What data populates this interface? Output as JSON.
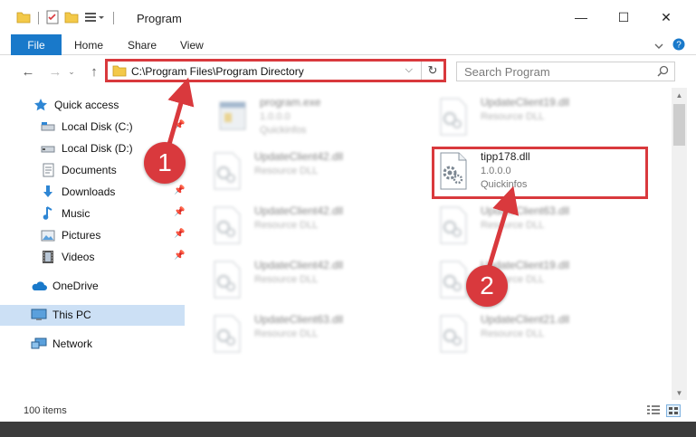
{
  "window": {
    "title": "Program",
    "controls": {
      "minimize": "—",
      "maximize": "☐",
      "close": "✕"
    }
  },
  "ribbon": {
    "file_label": "File",
    "tabs": [
      {
        "label": "Home"
      },
      {
        "label": "Share"
      },
      {
        "label": "View"
      }
    ]
  },
  "address_bar": {
    "path": "C:\\Program Files\\Program Directory",
    "search_placeholder": "Search Program"
  },
  "sidebar": {
    "items": [
      {
        "label": "Quick access",
        "icon": "star-icon"
      },
      {
        "label": "Local Disk (C:)",
        "icon": "drive-icon"
      },
      {
        "label": "Local Disk (D:)",
        "icon": "drive-icon"
      },
      {
        "label": "Documents",
        "icon": "document-icon"
      },
      {
        "label": "Downloads",
        "icon": "download-icon"
      },
      {
        "label": "Music",
        "icon": "music-icon"
      },
      {
        "label": "Pictures",
        "icon": "pictures-icon"
      },
      {
        "label": "Videos",
        "icon": "videos-icon"
      },
      {
        "label": "OneDrive",
        "icon": "cloud-icon"
      },
      {
        "label": "This PC",
        "icon": "computer-icon"
      },
      {
        "label": "Network",
        "icon": "network-icon"
      }
    ]
  },
  "files": [
    {
      "name": "program.exe",
      "meta1": "1.0.0.0",
      "meta2": "Quickinfos",
      "icon": "exe-icon",
      "blurred": true
    },
    {
      "name": "UpdateClient19.dll",
      "meta1": "Resource DLL",
      "meta2": "",
      "icon": "dll-icon",
      "blurred": true
    },
    {
      "name": "UpdateClient42.dll",
      "meta1": "Resource DLL",
      "meta2": "",
      "icon": "dll-icon",
      "blurred": true
    },
    {
      "name": "tipp178.dll",
      "meta1": "1.0.0.0",
      "meta2": "Quickinfos",
      "icon": "dll-gear-icon",
      "blurred": false
    },
    {
      "name": "UpdateClient42.dll",
      "meta1": "Resource DLL",
      "meta2": "",
      "icon": "dll-icon",
      "blurred": true
    },
    {
      "name": "UpdateClient63.dll",
      "meta1": "Resource DLL",
      "meta2": "",
      "icon": "dll-icon",
      "blurred": true
    },
    {
      "name": "UpdateClient42.dll",
      "meta1": "Resource DLL",
      "meta2": "",
      "icon": "dll-icon",
      "blurred": true
    },
    {
      "name": "UpdateClient19.dll",
      "meta1": "Resource DLL",
      "meta2": "",
      "icon": "dll-icon",
      "blurred": true
    },
    {
      "name": "UpdateClient63.dll",
      "meta1": "Resource DLL",
      "meta2": "",
      "icon": "dll-icon",
      "blurred": true
    },
    {
      "name": "UpdateClient21.dll",
      "meta1": "Resource DLL",
      "meta2": "",
      "icon": "dll-icon",
      "blurred": true
    }
  ],
  "status": {
    "item_count": "100 items"
  },
  "annotations": [
    {
      "label": "1"
    },
    {
      "label": "2"
    }
  ],
  "colors": {
    "accent": "#1979ca",
    "highlight": "#d9393d",
    "selection": "#cce0f5"
  }
}
